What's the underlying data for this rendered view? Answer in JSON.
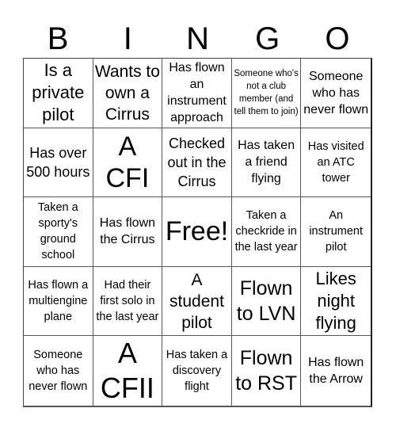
{
  "header": {
    "letters": [
      "B",
      "I",
      "N",
      "G",
      "O"
    ]
  },
  "cells": [
    "Is a private pilot",
    "Wants to own a Cirrus",
    "Has flown an instrument approach",
    "Someone who's not a club member (and tell them to join)",
    "Someone who has never flown",
    "Has over 500 hours",
    "A CFI",
    "Checked out in the Cirrus",
    "Has taken a friend flying",
    "Has visited an ATC tower",
    "Taken a sporty's ground school",
    "Has flown the Cirrus",
    "Free!",
    "Taken a checkride in the last year",
    "An instrument pilot",
    "Has flown a multiengine plane",
    "Had their first solo in the last year",
    "A student pilot",
    "Flown to LVN",
    "Likes night flying",
    "Someone who has never flown",
    "A CFII",
    "Has taken a discovery flight",
    "Flown to RST",
    "Has flown the Arrow"
  ]
}
